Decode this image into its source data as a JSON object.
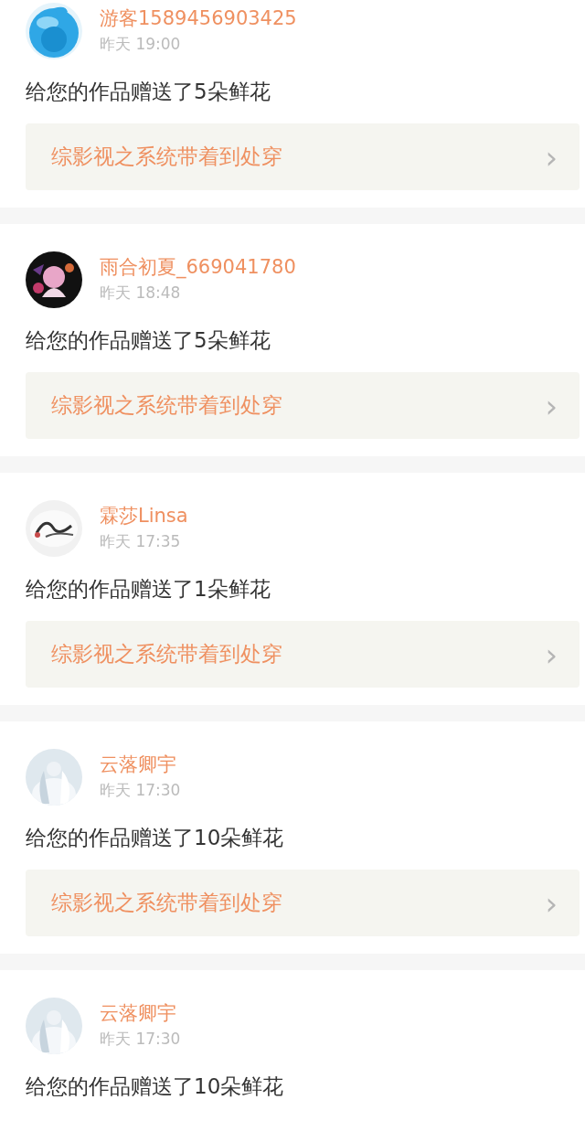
{
  "notifications": [
    {
      "name": "游客1589456903425",
      "time": "昨天 19:00",
      "message": "给您的作品赠送了5朵鲜花",
      "link": {
        "title": "综影视之系统带着到处穿",
        "chevron": "›"
      }
    },
    {
      "name": "雨合初夏_669041780",
      "time": "昨天 18:48",
      "message": "给您的作品赠送了5朵鲜花",
      "link": {
        "title": "综影视之系统带着到处穿",
        "chevron": "›"
      }
    },
    {
      "name": "霖莎Linsa",
      "time": "昨天 17:35",
      "message": "给您的作品赠送了1朵鲜花",
      "link": {
        "title": "综影视之系统带着到处穿",
        "chevron": "›"
      }
    },
    {
      "name": "云落卿宇",
      "time": "昨天 17:30",
      "message": "给您的作品赠送了10朵鲜花",
      "link": {
        "title": "综影视之系统带着到处穿",
        "chevron": "›"
      }
    },
    {
      "name": "云落卿宇",
      "time": "昨天 17:30",
      "message": "给您的作品赠送了10朵鲜花"
    }
  ]
}
